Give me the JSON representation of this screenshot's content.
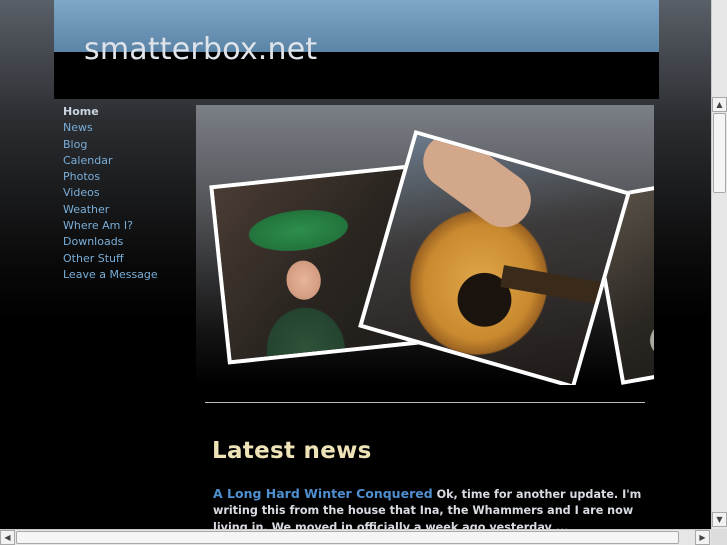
{
  "header": {
    "site_title": "smatterbox.net"
  },
  "nav": {
    "items": [
      {
        "label": "Home",
        "current": true
      },
      {
        "label": "News"
      },
      {
        "label": "Blog"
      },
      {
        "label": "Calendar"
      },
      {
        "label": "Photos"
      },
      {
        "label": "Videos"
      },
      {
        "label": "Weather"
      },
      {
        "label": "Where Am I?"
      },
      {
        "label": "Downloads"
      },
      {
        "label": "Other Stuff"
      },
      {
        "label": "Leave a Message"
      }
    ]
  },
  "main": {
    "heading": "Latest news",
    "news": [
      {
        "title": "A Long Hard Winter Conquered",
        "excerpt": "Ok, time for another update. I'm writing this from the house that Ina, the Whammers and I are now living in. We moved in officially a week ago yesterday ..."
      }
    ]
  },
  "colors": {
    "nav_link": "#79aed9",
    "news_link": "#4f8fd0",
    "heading": "#efe4b8"
  },
  "icons": {
    "scroll_up": "triangle-up",
    "scroll_down": "triangle-down",
    "scroll_left": "triangle-left",
    "scroll_right": "triangle-right"
  }
}
